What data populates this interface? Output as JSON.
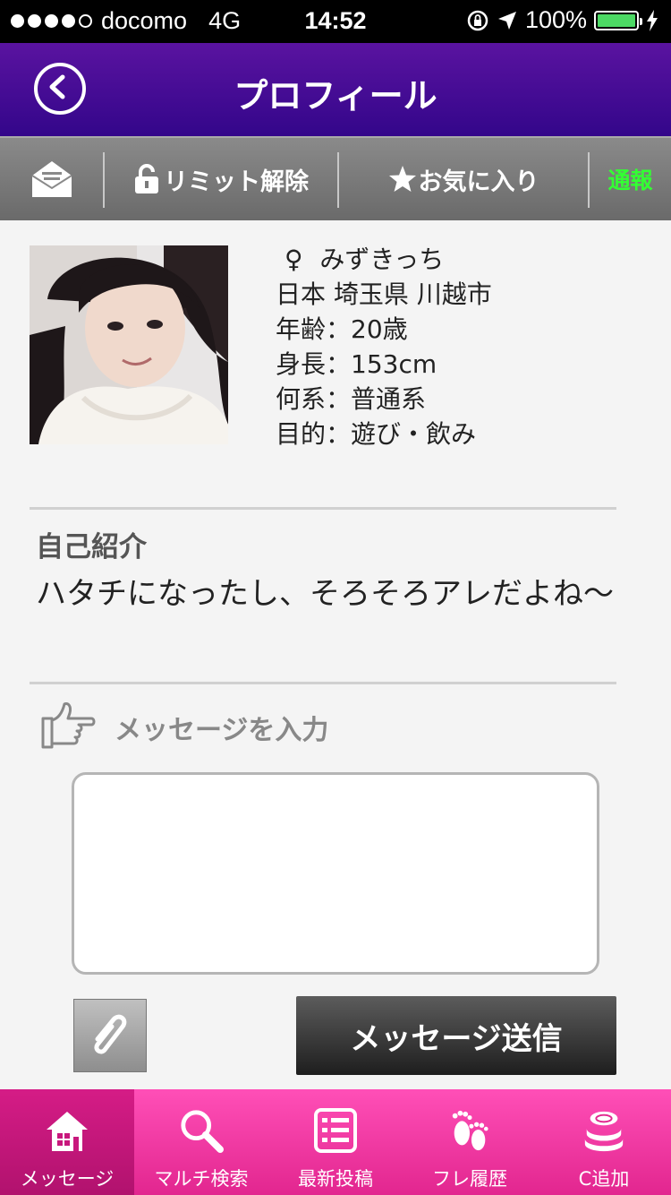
{
  "status_bar": {
    "carrier": "docomo",
    "network": "4G",
    "time": "14:52",
    "battery": "100%",
    "battery_level": 1.0
  },
  "header": {
    "title": "プロフィール"
  },
  "toolbar": {
    "limit_label": "リミット解除",
    "favorite_label": "お気に入り",
    "report_label": "通報",
    "report_color": "#33ff33"
  },
  "profile": {
    "gender_symbol": "♀",
    "name": "みずきっち",
    "location": "日本 埼玉県 川越市",
    "age": "年齢：20歳",
    "height": "身長：153cm",
    "type": "何系：普通系",
    "purpose": "目的：遊び・飲み"
  },
  "intro": {
    "title": "自己紹介",
    "text": "ハタチになったし、そろそろアレだよね～"
  },
  "message": {
    "heading": "メッセージを入力",
    "input_value": "",
    "send_label": "メッセージ送信"
  },
  "tabs": [
    {
      "label": "メッセージ",
      "icon": "house-icon",
      "active": true
    },
    {
      "label": "マルチ検索",
      "icon": "search-icon",
      "active": false
    },
    {
      "label": "最新投稿",
      "icon": "list-icon",
      "active": false
    },
    {
      "label": "フレ履歴",
      "icon": "footprints-icon",
      "active": false
    },
    {
      "label": "C追加",
      "icon": "coins-icon",
      "active": false
    }
  ],
  "colors": {
    "header": "#3a0890",
    "tab_bar": "#f03aa3",
    "tab_active": "#c0157a",
    "report": "#33ff33"
  }
}
